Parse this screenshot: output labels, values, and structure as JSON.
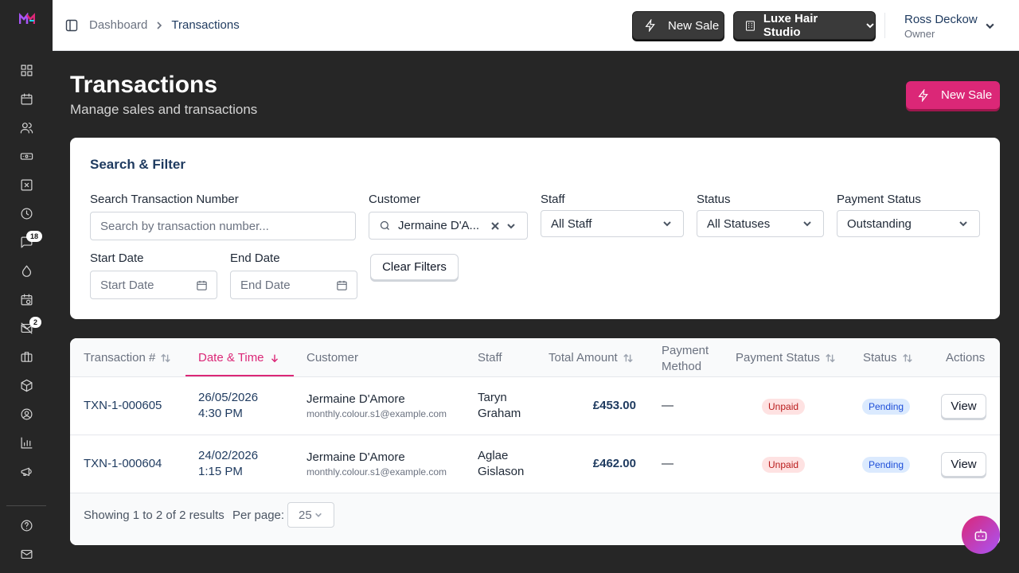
{
  "colors": {
    "accent": "#db2777",
    "sidebar": "#262626",
    "unpaid_bg": "#fee2e2",
    "pending_bg": "#dbeafe"
  },
  "sidebar": {
    "items": [
      {
        "icon": "dashboard-icon"
      },
      {
        "icon": "calendar-icon"
      },
      {
        "icon": "users-icon"
      },
      {
        "icon": "ticket-icon"
      },
      {
        "icon": "x-square-icon"
      },
      {
        "icon": "clock-icon"
      },
      {
        "icon": "messages-icon",
        "badge": "18"
      },
      {
        "icon": "droplet-icon"
      },
      {
        "icon": "calendar-clock-icon"
      },
      {
        "icon": "mail-off-icon",
        "badge": "2"
      },
      {
        "icon": "briefcase-icon"
      },
      {
        "icon": "box-icon"
      },
      {
        "icon": "user-circle-icon"
      },
      {
        "icon": "bar-chart-icon"
      },
      {
        "icon": "megaphone-icon"
      }
    ],
    "bottom": [
      {
        "icon": "help-circle-icon"
      },
      {
        "icon": "mail-icon"
      }
    ]
  },
  "topbar": {
    "breadcrumb": [
      "Dashboard",
      "Transactions"
    ],
    "new_sale_label": "New Sale",
    "studio_label": "Luxe Hair Studio",
    "user_name": "Ross Deckow",
    "user_role": "Owner"
  },
  "header": {
    "title": "Transactions",
    "subtitle": "Manage sales and transactions",
    "new_sale_label": "New Sale"
  },
  "filters": {
    "title": "Search & Filter",
    "search_label": "Search Transaction Number",
    "search_placeholder": "Search by transaction number...",
    "customer_label": "Customer",
    "customer_value": "Jermaine D'A...",
    "staff_label": "Staff",
    "staff_value": "All Staff",
    "status_label": "Status",
    "status_value": "All Statuses",
    "payment_label": "Payment Status",
    "payment_value": "Outstanding",
    "start_label": "Start Date",
    "start_placeholder": "Start Date",
    "end_label": "End Date",
    "end_placeholder": "End Date",
    "clear_label": "Clear Filters"
  },
  "table": {
    "columns": {
      "txn": "Transaction #",
      "date": "Date & Time",
      "customer": "Customer",
      "staff": "Staff",
      "amount": "Total Amount",
      "method_1": "Payment",
      "method_2": "Method",
      "pay_status": "Payment Status",
      "status": "Status",
      "actions": "Actions"
    },
    "rows": [
      {
        "txn": "TXN-1-000605",
        "date": "26/05/2026",
        "time": "4:30 PM",
        "customer": "Jermaine D'Amore",
        "email": "monthly.colour.s1@example.com",
        "staff_1": "Taryn",
        "staff_2": "Graham",
        "amount": "£453.00",
        "method": "—",
        "pay_status": "Unpaid",
        "status": "Pending",
        "action": "View"
      },
      {
        "txn": "TXN-1-000604",
        "date": "24/02/2026",
        "time": "1:15 PM",
        "customer": "Jermaine D'Amore",
        "email": "monthly.colour.s1@example.com",
        "staff_1": "Aglae",
        "staff_2": "Gislason",
        "amount": "£462.00",
        "method": "—",
        "pay_status": "Unpaid",
        "status": "Pending",
        "action": "View"
      }
    ],
    "footer": {
      "showing": "Showing 1 to 2 of 2 results",
      "per_page_label": "Per page:",
      "per_page_value": "25"
    }
  }
}
